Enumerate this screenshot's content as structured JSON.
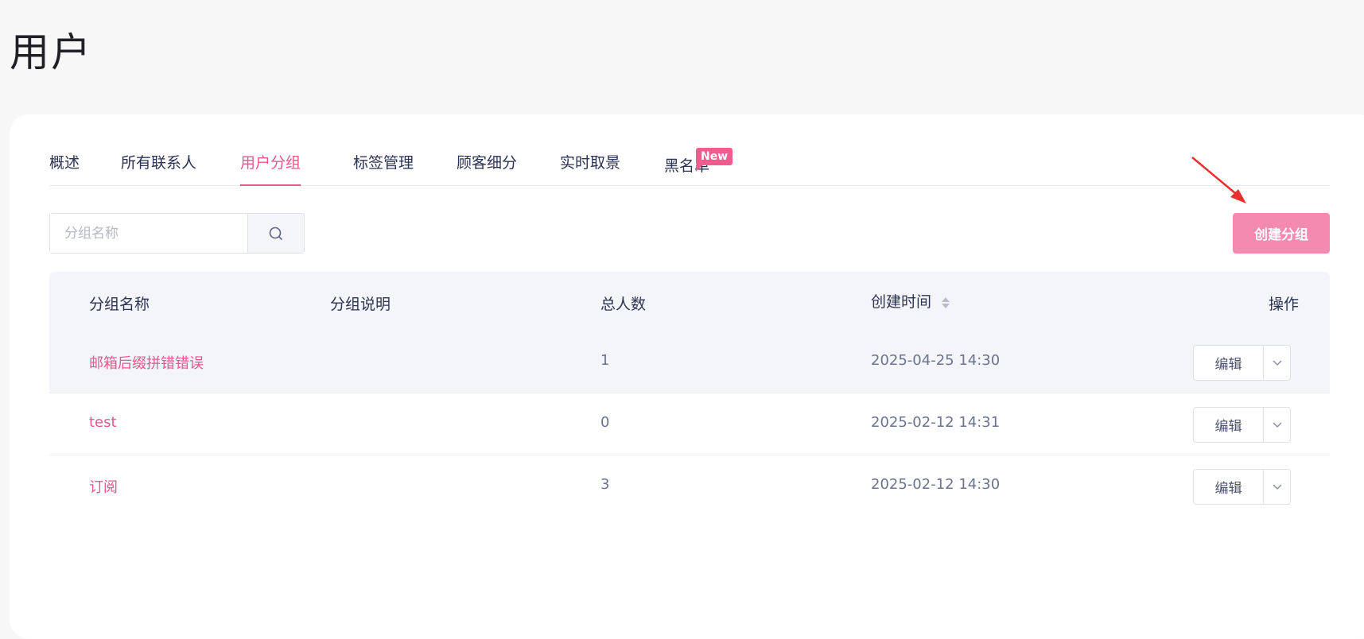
{
  "page": {
    "title": "用户"
  },
  "tabs": [
    {
      "label": "概述",
      "active": false
    },
    {
      "label": "所有联系人",
      "active": false
    },
    {
      "label": "用户分组",
      "active": true
    },
    {
      "label": "标签管理",
      "active": false
    },
    {
      "label": "顾客细分",
      "active": false
    },
    {
      "label": "实时取景",
      "active": false
    },
    {
      "label": "黑名单",
      "active": false,
      "badge": "New"
    }
  ],
  "search": {
    "placeholder": "分组名称",
    "value": "",
    "icon": "search-icon"
  },
  "toolbar": {
    "create_label": "创建分组"
  },
  "table": {
    "headers": {
      "name": "分组名称",
      "description": "分组说明",
      "total": "总人数",
      "created": "创建时间",
      "actions": "操作"
    },
    "rows": [
      {
        "name": "邮箱后缀拼错错误",
        "description": "",
        "total": "1",
        "created": "2025-04-25 14:30",
        "edit_label": "编辑"
      },
      {
        "name": "test",
        "description": "",
        "total": "0",
        "created": "2025-02-12 14:31",
        "edit_label": "编辑"
      },
      {
        "name": "订阅",
        "description": "",
        "total": "3",
        "created": "2025-02-12 14:30",
        "edit_label": "编辑"
      }
    ]
  },
  "colors": {
    "accent": "#e8588a",
    "create_button": "#f58ab0",
    "badge": "#ef5d8f",
    "annotation_arrow": "#e8302c"
  }
}
